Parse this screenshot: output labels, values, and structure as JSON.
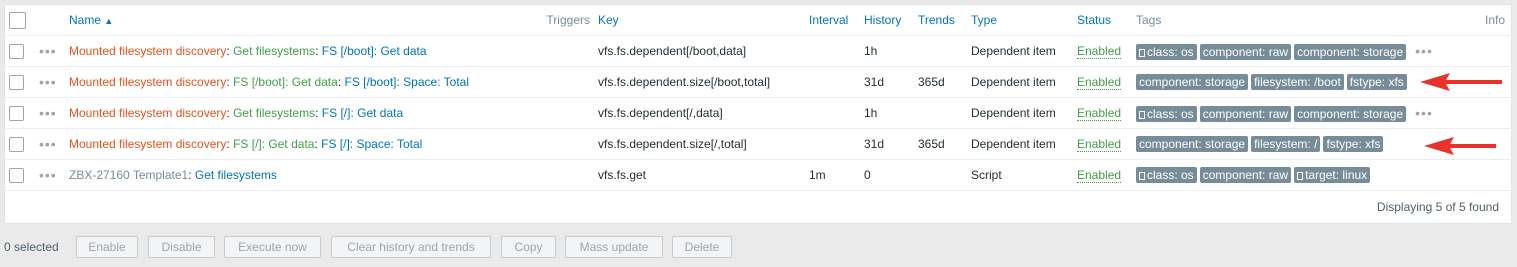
{
  "columns": {
    "name": "Name",
    "triggers": "Triggers",
    "key": "Key",
    "interval": "Interval",
    "history": "History",
    "trends": "Trends",
    "type": "Type",
    "status": "Status",
    "tags": "Tags",
    "info": "Info"
  },
  "rows": [
    {
      "parts": [
        "Mounted filesystem discovery",
        "Get filesystems",
        "FS [/boot]: Get data"
      ],
      "key": "vfs.fs.dependent[/boot,data]",
      "interval": "",
      "history": "1h",
      "trends": "",
      "type": "Dependent item",
      "status": "Enabled",
      "tags": [
        "class: os",
        "component: raw",
        "component: storage"
      ]
    },
    {
      "parts": [
        "Mounted filesystem discovery",
        "FS [/boot]: Get data",
        "FS [/boot]: Space: Total"
      ],
      "key": "vfs.fs.dependent.size[/boot,total]",
      "interval": "",
      "history": "31d",
      "trends": "365d",
      "type": "Dependent item",
      "status": "Enabled",
      "tags": [
        "component: storage",
        "filesystem: /boot",
        "fstype: xfs"
      ]
    },
    {
      "parts": [
        "Mounted filesystem discovery",
        "Get filesystems",
        "FS [/]: Get data"
      ],
      "key": "vfs.fs.dependent[/,data]",
      "interval": "",
      "history": "1h",
      "trends": "",
      "type": "Dependent item",
      "status": "Enabled",
      "tags": [
        "class: os",
        "component: raw",
        "component: storage"
      ]
    },
    {
      "parts": [
        "Mounted filesystem discovery",
        "FS [/]: Get data",
        "FS [/]: Space: Total"
      ],
      "key": "vfs.fs.dependent.size[/,total]",
      "interval": "",
      "history": "31d",
      "trends": "365d",
      "type": "Dependent item",
      "status": "Enabled",
      "tags": [
        "component: storage",
        "filesystem: /",
        "fstype: xfs"
      ]
    },
    {
      "parts": [
        "ZBX-27160 Template1",
        "Get filesystems"
      ],
      "key": "vfs.fs.get",
      "interval": "1m",
      "history": "0",
      "trends": "",
      "type": "Script",
      "status": "Enabled",
      "tags": [
        "class: os",
        "component: raw",
        "target: linux"
      ]
    }
  ],
  "footer": {
    "displaying": "Displaying 5 of 5 found"
  },
  "actions": {
    "selected": "0 selected",
    "enable": "Enable",
    "disable": "Disable",
    "execute_now": "Execute now",
    "clear_history": "Clear history and trends",
    "copy": "Copy",
    "mass_update": "Mass update",
    "delete": "Delete"
  },
  "colors": {
    "link": "#0275b8",
    "discovery": "#e0541f",
    "enabled": "#429e47",
    "tag_bg": "#768d99",
    "arrow": "#e8322b"
  }
}
